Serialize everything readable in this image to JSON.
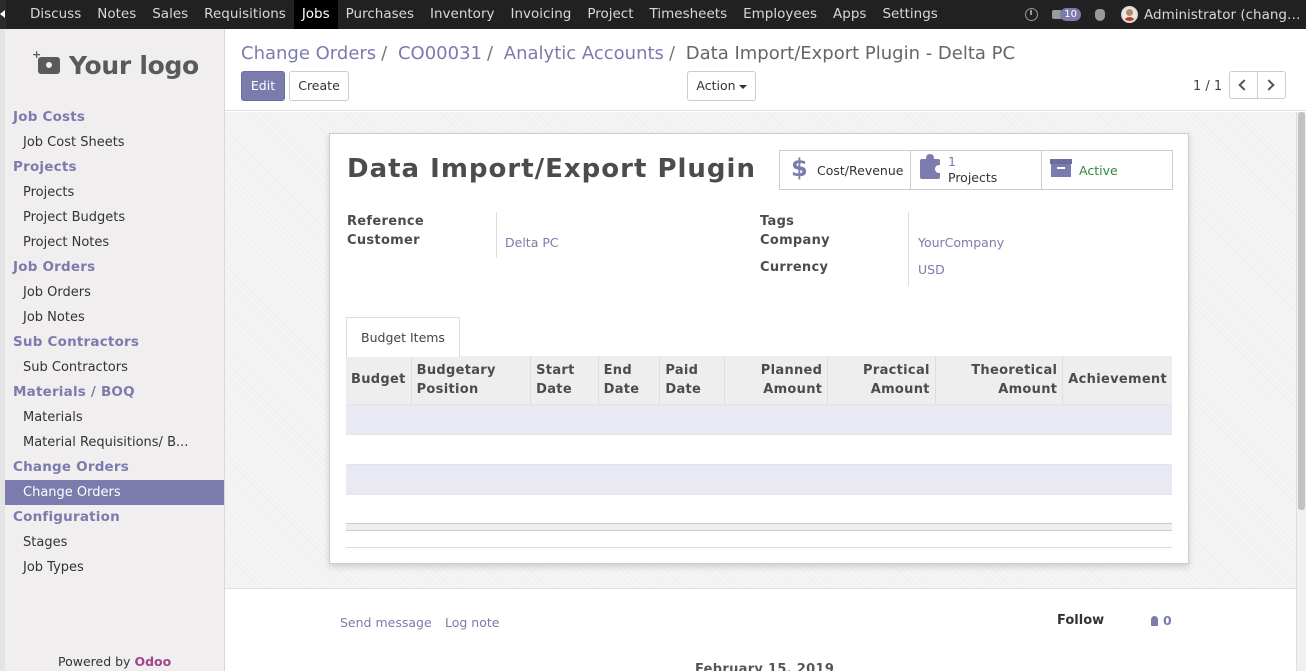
{
  "topbar": {
    "menu": [
      "Discuss",
      "Notes",
      "Sales",
      "Requisitions",
      "Jobs",
      "Purchases",
      "Inventory",
      "Invoicing",
      "Project",
      "Timesheets",
      "Employees",
      "Apps",
      "Settings"
    ],
    "active_menu": "Jobs",
    "message_count": "10",
    "user": "Administrator (chang…"
  },
  "sidebar": {
    "logo_text": "Your logo",
    "sections": [
      {
        "title": "Job Costs",
        "items": [
          "Job Cost Sheets"
        ]
      },
      {
        "title": "Projects",
        "items": [
          "Projects",
          "Project Budgets",
          "Project Notes"
        ]
      },
      {
        "title": "Job Orders",
        "items": [
          "Job Orders",
          "Job Notes"
        ]
      },
      {
        "title": "Sub Contractors",
        "items": [
          "Sub Contractors"
        ]
      },
      {
        "title": "Materials  /  BOQ",
        "items": [
          "Materials",
          "Material Requisitions/ B..."
        ]
      },
      {
        "title": "Change Orders",
        "items": [
          "Change Orders"
        ]
      },
      {
        "title": "Configuration",
        "items": [
          "Stages",
          "Job Types"
        ]
      }
    ],
    "active_item": "Change Orders",
    "powered_by": "Powered by",
    "powered_brand": "Odoo"
  },
  "breadcrumb": {
    "items": [
      "Change Orders",
      "CO00031",
      "Analytic Accounts"
    ],
    "current": "Data Import/Export Plugin - Delta PC"
  },
  "buttons": {
    "edit": "Edit",
    "create": "Create",
    "action": "Action"
  },
  "pager": {
    "text": "1 / 1"
  },
  "record": {
    "title": "Data Import/Export Plugin",
    "smart_buttons": {
      "cost_revenue": "Cost/Revenue",
      "projects_count": "1",
      "projects_label": "Projects",
      "status": "Active"
    },
    "fields": {
      "reference_label": "Reference",
      "customer_label": "Customer",
      "customer_value": "Delta PC",
      "tags_label": "Tags",
      "company_label": "Company",
      "company_value": "YourCompany",
      "currency_label": "Currency",
      "currency_value": "USD"
    },
    "tab": "Budget Items",
    "columns": [
      "Budget",
      "Budgetary Position",
      "Start Date",
      "End Date",
      "Paid Date",
      "Planned Amount",
      "Practical Amount",
      "Theoretical Amount",
      "Achievement"
    ]
  },
  "chatter": {
    "send_message": "Send message",
    "log_note": "Log note",
    "follow": "Follow",
    "followers": "0",
    "date_separator": "February 15, 2019"
  }
}
